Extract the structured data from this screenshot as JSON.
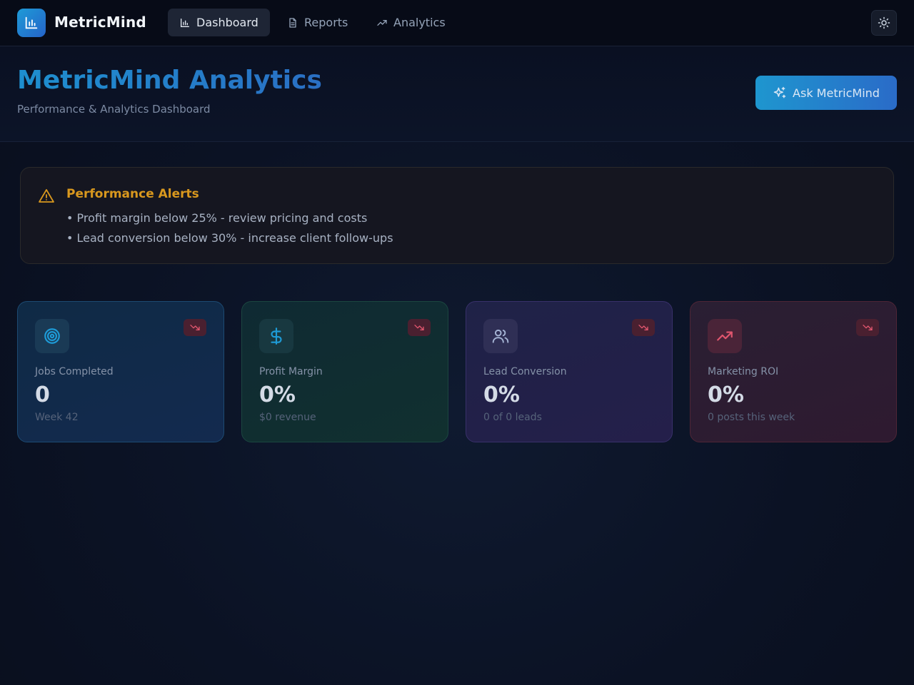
{
  "app": {
    "brand": "MetricMind",
    "accent": "#1e8fcf"
  },
  "nav": {
    "items": [
      {
        "label": "Dashboard",
        "icon": "bar-chart-icon",
        "active": true
      },
      {
        "label": "Reports",
        "icon": "document-icon",
        "active": false
      },
      {
        "label": "Analytics",
        "icon": "trending-up-icon",
        "active": false
      }
    ],
    "theme_toggle_icon": "sun-icon"
  },
  "header": {
    "title": "MetricMind Analytics",
    "subtitle": "Performance & Analytics Dashboard",
    "ask_button": "Ask MetricMind",
    "ask_icon": "sparkles-icon"
  },
  "alerts": {
    "title": "Performance Alerts",
    "icon": "warning-icon",
    "color": "#d9981e",
    "items": [
      "• Profit margin below 25% - review pricing and costs",
      "• Lead conversion below 30% - increase client follow-ups"
    ]
  },
  "cards": [
    {
      "label": "Jobs Completed",
      "value": "0",
      "sub": "Week 42",
      "icon": "target-icon",
      "trend": "trending-down-icon",
      "color": "#1e9bd7"
    },
    {
      "label": "Profit Margin",
      "value": "0%",
      "sub": "$0 revenue",
      "icon": "dollar-icon",
      "trend": "trending-down-icon",
      "color": "#1e9bd7"
    },
    {
      "label": "Lead Conversion",
      "value": "0%",
      "sub": "0 of 0 leads",
      "icon": "users-icon",
      "trend": "trending-down-icon",
      "color": "#a5b4d4"
    },
    {
      "label": "Marketing ROI",
      "value": "0%",
      "sub": "0 posts this week",
      "icon": "trending-up-icon",
      "trend": "trending-down-icon",
      "color": "#e0566e"
    }
  ]
}
